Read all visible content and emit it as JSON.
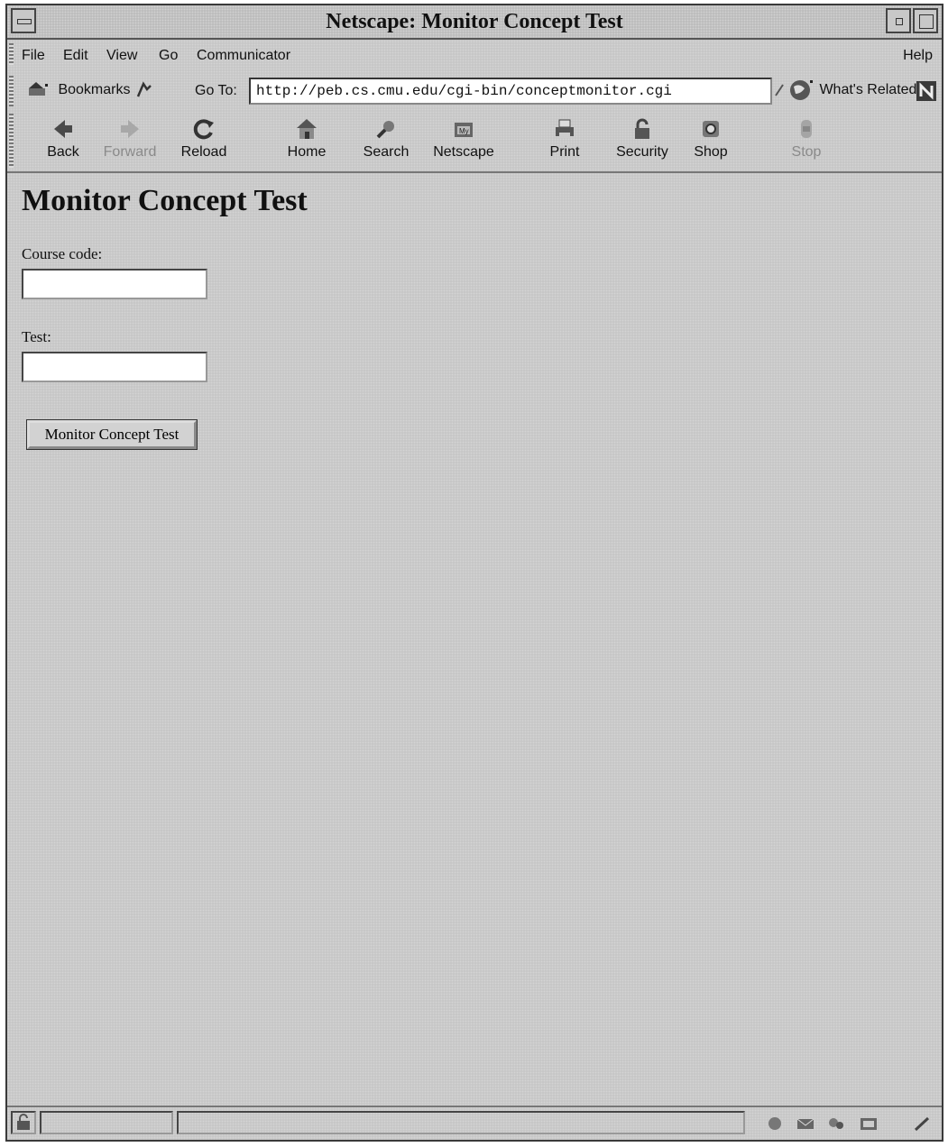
{
  "window": {
    "title": "Netscape: Monitor Concept Test"
  },
  "menu": {
    "items": [
      "File",
      "Edit",
      "View",
      "Go",
      "Communicator"
    ],
    "help": "Help"
  },
  "location_bar": {
    "bookmarks_label": "Bookmarks",
    "goto_label": "Go To:",
    "url": "http://peb.cs.cmu.edu/cgi-bin/conceptmonitor.cgi",
    "whats_related_label": "What's Related"
  },
  "toolbar": {
    "buttons": [
      {
        "label": "Back",
        "icon": "back-arrow-icon",
        "enabled": true
      },
      {
        "label": "Forward",
        "icon": "forward-arrow-icon",
        "enabled": false
      },
      {
        "label": "Reload",
        "icon": "reload-icon",
        "enabled": true
      },
      {
        "label": "Home",
        "icon": "home-icon",
        "enabled": true
      },
      {
        "label": "Search",
        "icon": "search-icon",
        "enabled": true
      },
      {
        "label": "Netscape",
        "icon": "netscape-icon",
        "enabled": true
      },
      {
        "label": "Print",
        "icon": "print-icon",
        "enabled": true
      },
      {
        "label": "Security",
        "icon": "security-lock-icon",
        "enabled": true
      },
      {
        "label": "Shop",
        "icon": "shop-icon",
        "enabled": true
      },
      {
        "label": "Stop",
        "icon": "stop-icon",
        "enabled": false
      }
    ]
  },
  "page": {
    "heading": "Monitor Concept Test",
    "course_label": "Course code:",
    "course_value": "",
    "test_label": "Test:",
    "test_value": "",
    "submit_label": "Monitor Concept Test"
  },
  "colors": {
    "chrome": "#c4c4c4",
    "field": "#ffffff",
    "text": "#111111"
  }
}
